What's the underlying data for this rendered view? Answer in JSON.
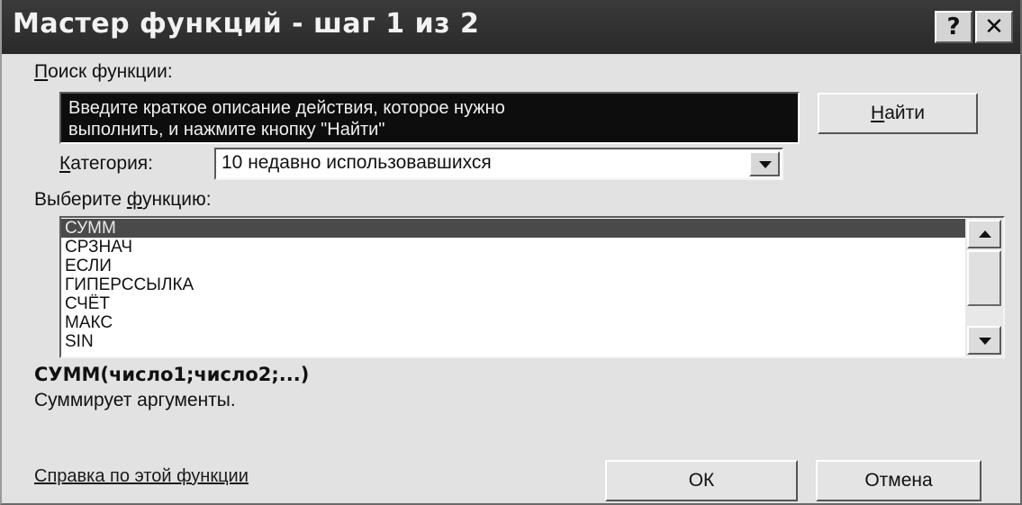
{
  "window": {
    "title": "Мастер функций - шаг 1 из 2",
    "help_glyph": "?",
    "close_glyph": "✕"
  },
  "search": {
    "label_hotkey": "П",
    "label_rest": "оиск функции:",
    "value": "Введите краткое описание действия, которое нужно\nвыполнить, и нажмите кнопку \"Найти\"",
    "find_hotkey": "Н",
    "find_rest": "айти"
  },
  "category": {
    "label_hotkey": "К",
    "label_rest": "атегория:",
    "selected": "10 недавно использовавшихся"
  },
  "function_list": {
    "label_before": "Выберите ",
    "label_hotkey": "ф",
    "label_rest": "ункцию:",
    "items": [
      "СУММ",
      "СРЗНАЧ",
      "ЕСЛИ",
      "ГИПЕРССЫЛКА",
      "СЧЁТ",
      "МАКС",
      "SIN"
    ],
    "selected_index": 0
  },
  "details": {
    "signature": "СУММ(число1;число2;...)",
    "description": "Суммирует аргументы."
  },
  "footer": {
    "help_link": "Справка по этой функции",
    "ok_label": "ОК",
    "cancel_label": "Отмена"
  },
  "icons": {
    "help": "question-mark-icon",
    "close": "close-icon",
    "dropdown": "chevron-down-icon",
    "scroll_up": "scroll-up-arrow-icon",
    "scroll_down": "scroll-down-arrow-icon"
  }
}
